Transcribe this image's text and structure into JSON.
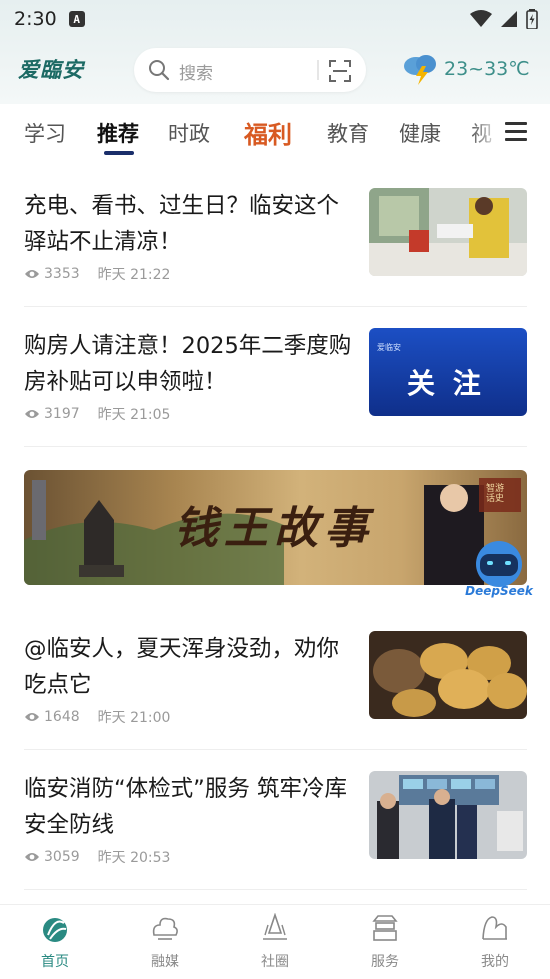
{
  "status_bar": {
    "time": "2:30",
    "notification_badge": "A"
  },
  "header": {
    "logo_text": "爱臨安",
    "search_placeholder": "搜索",
    "weather_temp": "23~33℃"
  },
  "tabs": [
    {
      "label": "学习"
    },
    {
      "label": "推荐",
      "active": true
    },
    {
      "label": "时政"
    },
    {
      "label": "福利",
      "special": true
    },
    {
      "label": "教育"
    },
    {
      "label": "健康"
    },
    {
      "label": "视"
    }
  ],
  "news": [
    {
      "title": "充电、看书、过生日？临安这个驿站不止清凉！",
      "views": "3353",
      "time": "昨天 21:22"
    },
    {
      "title": "购房人请注意！2025年二季度购房补贴可以申领啦！",
      "views": "3197",
      "time": "昨天 21:05",
      "thumb_text": "关  注",
      "thumb_logo": "爱临安"
    },
    {
      "title": "@临安人，夏天浑身没劲，劝你吃点它",
      "views": "1648",
      "time": "昨天 21:00"
    },
    {
      "title": "临安消防“体检式”服务 筑牢冷库安全防线",
      "views": "3059",
      "time": "昨天 20:53"
    }
  ],
  "banner": {
    "title": "钱王故事",
    "badge": "智游话史",
    "robot_label": "DeepSeek"
  },
  "bottom_nav": [
    {
      "label": "首页",
      "active": true
    },
    {
      "label": "融媒"
    },
    {
      "label": "社圈"
    },
    {
      "label": "服务"
    },
    {
      "label": "我的"
    }
  ],
  "colors": {
    "accent": "#2a8a82",
    "tab_underline": "#1a2e6a",
    "special_tab": "#d85a22"
  }
}
